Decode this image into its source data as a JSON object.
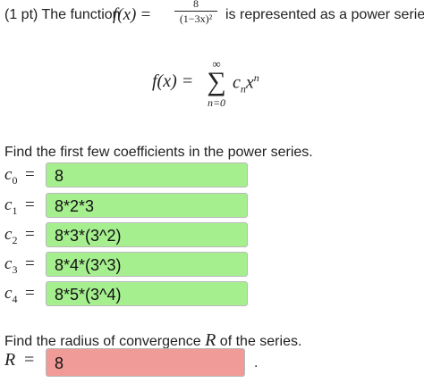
{
  "header": {
    "prefix": "(1 pt) The function ",
    "func": "f(x)",
    "equals": "=",
    "numerator": "8",
    "denominator": "(1−3x)²",
    "suffix": "is represented as a power series:"
  },
  "series": {
    "lhs": "f(x) =",
    "upper": "∞",
    "sigma": "∑",
    "lower": "n=0",
    "coef": "c",
    "coef_sub": "n",
    "var": "x",
    "var_sup": "n"
  },
  "coefficients": {
    "prompt": "Find the first few coefficients in the power series.",
    "rows": [
      {
        "symbol": "c",
        "index": "0",
        "equals": "=",
        "value": "8"
      },
      {
        "symbol": "c",
        "index": "1",
        "equals": "=",
        "value": "8*2*3"
      },
      {
        "symbol": "c",
        "index": "2",
        "equals": "=",
        "value": "8*3*(3^2)"
      },
      {
        "symbol": "c",
        "index": "3",
        "equals": "=",
        "value": "8*4*(3^3)"
      },
      {
        "symbol": "c",
        "index": "4",
        "equals": "=",
        "value": "8*5*(3^4)"
      }
    ],
    "status_color": "#a6ef8f"
  },
  "radius": {
    "prompt_before": "Find the radius of convergence ",
    "symbol": "R",
    "prompt_after": " of the series.",
    "equals": "=",
    "value": "8",
    "period": ".",
    "status_color": "#f09b97"
  }
}
